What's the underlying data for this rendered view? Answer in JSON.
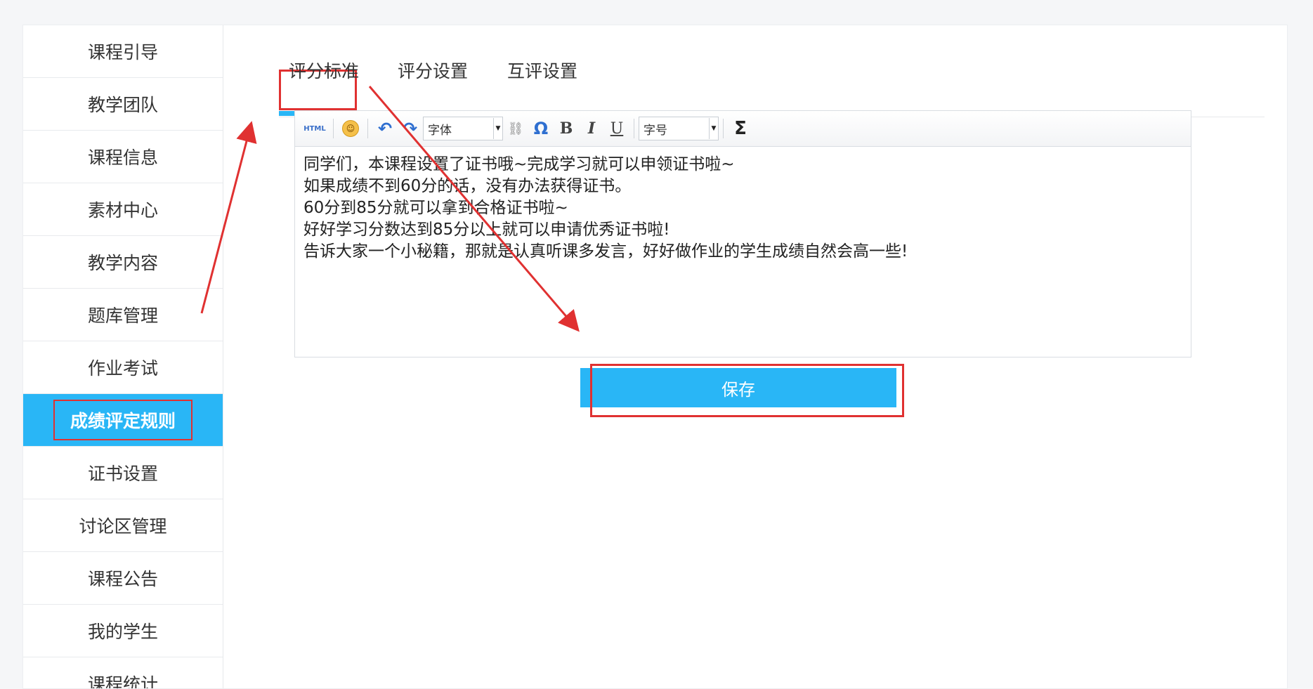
{
  "sidebar": {
    "items": [
      {
        "label": "课程引导"
      },
      {
        "label": "教学团队"
      },
      {
        "label": "课程信息"
      },
      {
        "label": "素材中心"
      },
      {
        "label": "教学内容"
      },
      {
        "label": "题库管理"
      },
      {
        "label": "作业考试"
      },
      {
        "label": "成绩评定规则",
        "active": true
      },
      {
        "label": "证书设置"
      },
      {
        "label": "讨论区管理"
      },
      {
        "label": "课程公告"
      },
      {
        "label": "我的学生"
      },
      {
        "label": "课程统计"
      }
    ]
  },
  "tabs": [
    {
      "label": "评分标准",
      "active": true
    },
    {
      "label": "评分设置"
    },
    {
      "label": "互评设置"
    }
  ],
  "editor": {
    "toolbar": {
      "html_label": "HTML",
      "font_select": "字体",
      "size_select": "字号"
    },
    "lines": [
      "同学们，本课程设置了证书哦~完成学习就可以申领证书啦~",
      "如果成绩不到60分的话，没有办法获得证书。",
      "60分到85分就可以拿到合格证书啦~",
      "好好学习分数达到85分以上就可以申请优秀证书啦!",
      "告诉大家一个小秘籍，那就是认真听课多发言，好好做作业的学生成绩自然会高一些!"
    ]
  },
  "save_button": "保存",
  "colors": {
    "accent": "#29b6f6",
    "annotation_red": "#e03131"
  }
}
